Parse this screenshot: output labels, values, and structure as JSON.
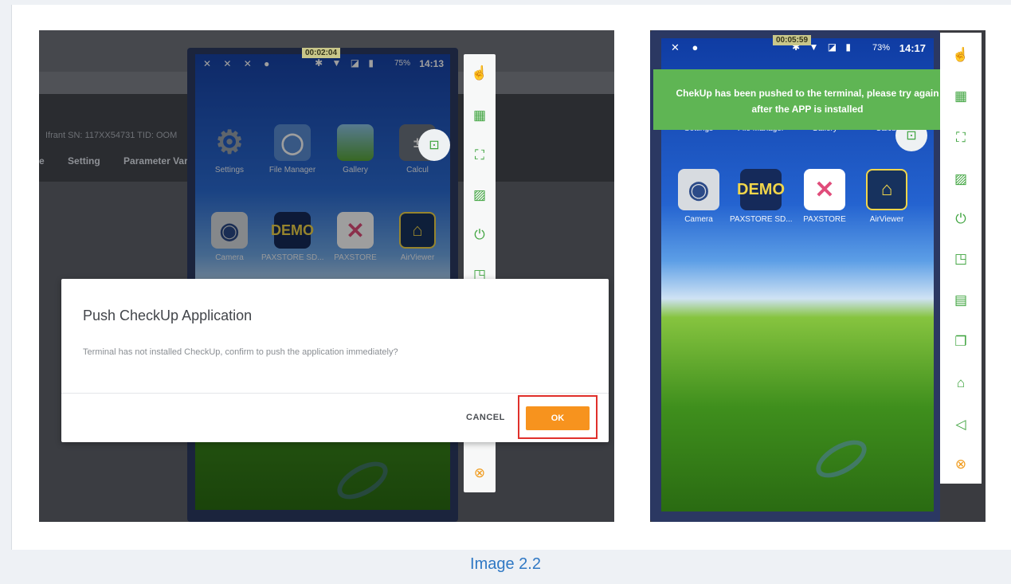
{
  "caption": "Image 2.2",
  "left_shot": {
    "background": {
      "info_line": "Ifrant   SN: 117XX54731   TID: OOM",
      "menu": [
        "e",
        "Setting",
        "Parameter Vari"
      ]
    },
    "timer": "00:02:04",
    "status": {
      "left_icons": "✕ ✕ ✕ ●",
      "right_icons": "✱ ▼ ◪ ▮",
      "battery": "75%",
      "time": "14:13"
    },
    "apps_row1": [
      {
        "label": "Settings",
        "icon": "gear-icon"
      },
      {
        "label": "File Manager",
        "icon": "folder-icon"
      },
      {
        "label": "Gallery",
        "icon": "image-icon"
      },
      {
        "label": "Calcul",
        "icon": "calculator-icon"
      }
    ],
    "apps_row2": [
      {
        "label": "Camera",
        "icon": "camera-icon"
      },
      {
        "label": "PAXSTORE SD...",
        "icon": "demo-icon",
        "text": "DEMO"
      },
      {
        "label": "PAXSTORE",
        "icon": "paxstore-icon"
      },
      {
        "label": "AirViewer",
        "icon": "airviewer-icon"
      }
    ],
    "dialog": {
      "title": "Push CheckUp Application",
      "message": "Terminal has not installed CheckUp, confirm to push the application immediately?",
      "cancel_label": "CANCEL",
      "ok_label": "OK"
    }
  },
  "right_shot": {
    "timer": "00:05:59",
    "status": {
      "left_icons": "✕ ●",
      "right_icons": "✱ ▼ ◪ ▮",
      "battery": "73%",
      "time": "14:17"
    },
    "toast_line1": "ChekUp has been pushed to the terminal, please try again",
    "toast_line2": "after the APP is installed",
    "apps_row1": [
      {
        "label": "Settings"
      },
      {
        "label": "File Manager"
      },
      {
        "label": "Gallery"
      },
      {
        "label": "Calcul"
      }
    ],
    "apps_row2": [
      {
        "label": "Camera",
        "icon": "camera-icon"
      },
      {
        "label": "PAXSTORE SD...",
        "icon": "demo-icon",
        "text": "DEMO"
      },
      {
        "label": "PAXSTORE",
        "icon": "paxstore-icon"
      },
      {
        "label": "AirViewer",
        "icon": "airviewer-icon"
      }
    ]
  },
  "toolbar_icons": [
    "hand-pointer-icon",
    "grid-icon",
    "fullscreen-icon",
    "screenshot-icon",
    "power-icon",
    "file-icon",
    "clipboard-icon",
    "window-icon",
    "home-icon",
    "back-icon",
    "close-circle-icon"
  ],
  "colors": {
    "accent_orange": "#f7931e",
    "highlight_red": "#e0302b",
    "toast_green": "#5fb554",
    "caption_blue": "#2f78c4",
    "tool_green": "#3da33d"
  }
}
